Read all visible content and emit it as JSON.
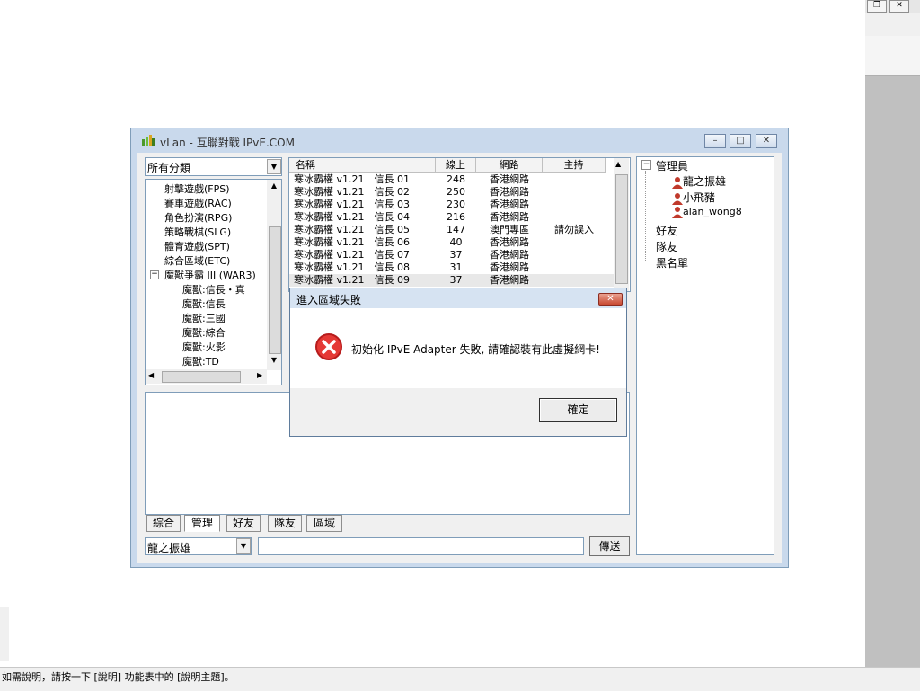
{
  "window": {
    "title": "vLan - 互聯對戰 IPvE.COM",
    "minimize_label": "–",
    "maximize_label": "□",
    "close_label": "✕"
  },
  "host": {
    "restore_label": "❐",
    "close_label": "✕",
    "status_text": "如需說明，請按一下 [說明] 功能表中的 [說明主題]。"
  },
  "category_combo": {
    "value": "所有分類",
    "arrow": "▼"
  },
  "category_tree": [
    {
      "label": "射擊遊戲(FPS)"
    },
    {
      "label": "賽車遊戲(RAC)"
    },
    {
      "label": "角色扮演(RPG)"
    },
    {
      "label": "策略戰棋(SLG)"
    },
    {
      "label": "體育遊戲(SPT)"
    },
    {
      "label": "綜合區域(ETC)"
    },
    {
      "label": "魔獸爭霸 III (WAR3)",
      "expander": "−"
    },
    {
      "label": "魔獸:信長・真"
    },
    {
      "label": "魔獸:信長"
    },
    {
      "label": "魔獸:三國"
    },
    {
      "label": "魔獸:綜合"
    },
    {
      "label": "魔獸:火影"
    },
    {
      "label": "魔獸:TD"
    }
  ],
  "room_table": {
    "headers": [
      "名稱",
      "線上",
      "網路",
      "主持"
    ],
    "rows": [
      {
        "name": "寒冰霸權 v1.21　信長 01",
        "online": "248",
        "network": "香港網路",
        "host": ""
      },
      {
        "name": "寒冰霸權 v1.21　信長 02",
        "online": "250",
        "network": "香港網路",
        "host": ""
      },
      {
        "name": "寒冰霸權 v1.21　信長 03",
        "online": "230",
        "network": "香港網路",
        "host": ""
      },
      {
        "name": "寒冰霸權 v1.21　信長 04",
        "online": "216",
        "network": "香港網路",
        "host": ""
      },
      {
        "name": "寒冰霸權 v1.21　信長 05",
        "online": "147",
        "network": "澳門專區",
        "host": "請勿誤入"
      },
      {
        "name": "寒冰霸權 v1.21　信長 06",
        "online": "40",
        "network": "香港網路",
        "host": ""
      },
      {
        "name": "寒冰霸權 v1.21　信長 07",
        "online": "37",
        "network": "香港網路",
        "host": ""
      },
      {
        "name": "寒冰霸權 v1.21　信長 08",
        "online": "31",
        "network": "香港網路",
        "host": ""
      },
      {
        "name": "寒冰霸權 v1.21　信長 09",
        "online": "37",
        "network": "香港網路",
        "host": ""
      }
    ]
  },
  "tabs": [
    "綜合",
    "管理",
    "好友",
    "隊友",
    "區域"
  ],
  "chat": {
    "user_combo_value": "龍之振雄",
    "input_value": "",
    "send_label": "傳送"
  },
  "user_tree": {
    "admin_group": "管理員",
    "admins": [
      "龍之振雄",
      "小飛豬",
      "alan_wong8"
    ],
    "friends": "好友",
    "teammates": "隊友",
    "blacklist": "黑名單"
  },
  "dialog": {
    "title": "進入區域失敗",
    "message": "初始化 IPvE Adapter 失敗, 請確認裝有此虛擬網卡!",
    "ok_label": "確定",
    "close_label": "✕"
  },
  "colors": {
    "window_frame": "#c9d9ec",
    "dialog_close": "#c94a33",
    "error_icon": "#d21f1f"
  }
}
